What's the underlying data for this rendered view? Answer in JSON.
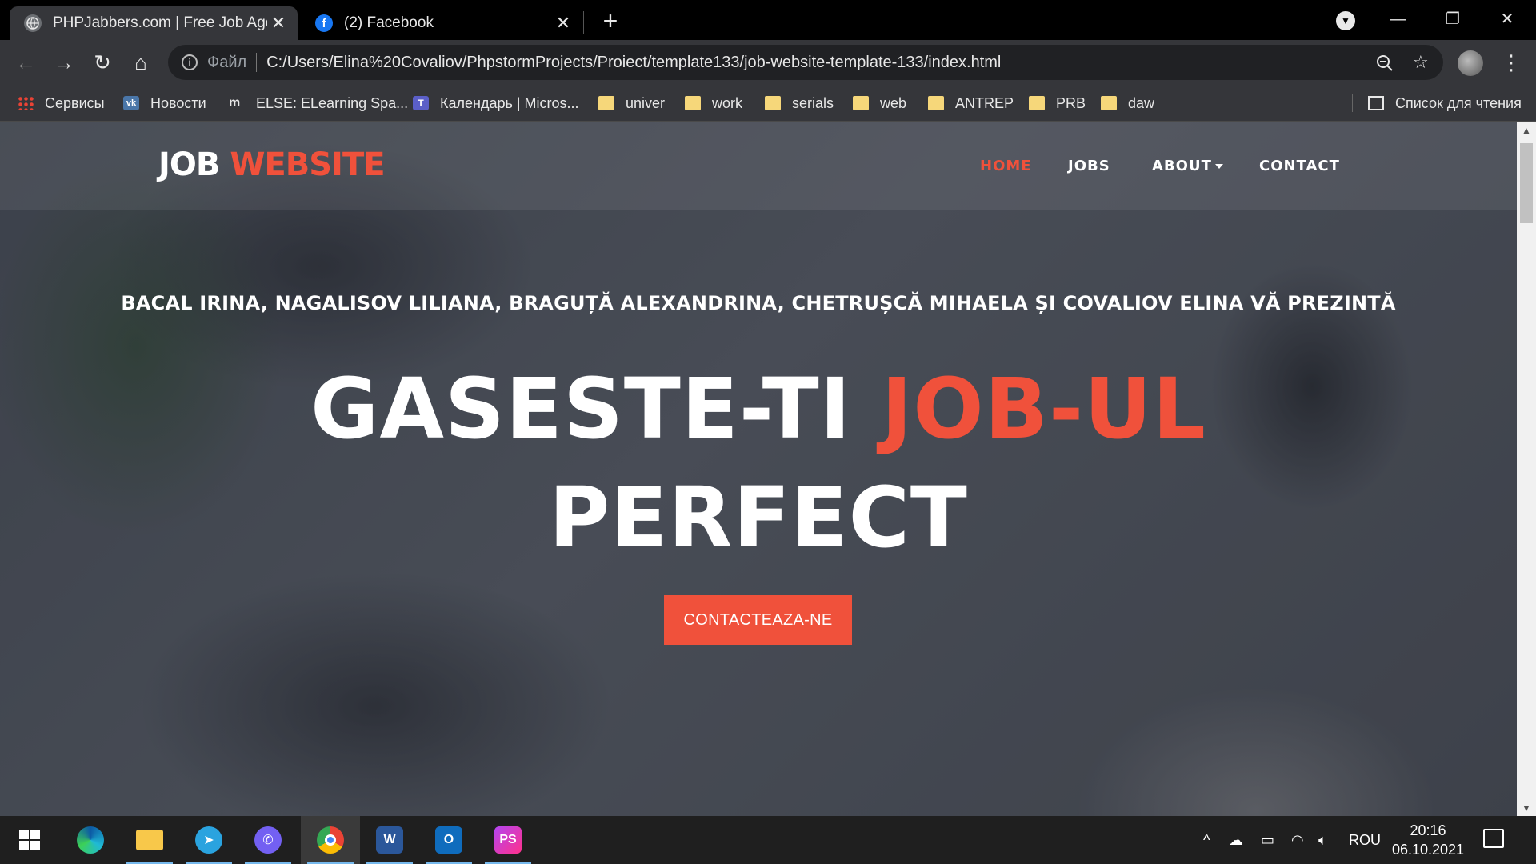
{
  "browser": {
    "tabs": [
      {
        "title": "PHPJabbers.com | Free Job Agency",
        "favicon": "globe-icon",
        "active": true
      },
      {
        "title": "(2) Facebook",
        "favicon": "facebook-icon",
        "active": false
      }
    ],
    "address": {
      "scheme_label": "Файл",
      "url": "C:/Users/Elina%20Covaliov/PhpstormProjects/Proiect/template133/job-website-template-133/index.html"
    },
    "bookmarks": [
      {
        "label": "Сервисы",
        "icon": "apps-grid-icon"
      },
      {
        "label": "Новости",
        "icon": "vk-icon"
      },
      {
        "label": "ELSE: ELearning Spa...",
        "icon": "moodle-icon"
      },
      {
        "label": "Календарь | Micros...",
        "icon": "teams-icon"
      },
      {
        "label": "univer",
        "icon": "folder-icon"
      },
      {
        "label": "work",
        "icon": "folder-icon"
      },
      {
        "label": "serials",
        "icon": "folder-icon"
      },
      {
        "label": "web",
        "icon": "folder-icon"
      },
      {
        "label": "ANTREP",
        "icon": "folder-icon"
      },
      {
        "label": "PRB",
        "icon": "folder-icon"
      },
      {
        "label": "daw",
        "icon": "folder-icon"
      }
    ],
    "reading_list": "Список для чтения"
  },
  "site": {
    "logo": {
      "part1": "JOB",
      "part2": "WEBSITE"
    },
    "nav": {
      "home": "HOME",
      "jobs": "JOBS",
      "about": "ABOUT",
      "contact": "CONTACT"
    },
    "hero": {
      "subtitle": "BACAL IRINA, NAGALISOV LILIANA, BRAGUȚĂ ALEXANDRINA, CHETRUȘCĂ MIHAELA ȘI COVALIOV ELINA VĂ PREZINTĂ",
      "headline_part1": "GASESTE-TI",
      "headline_accent": "JOB-UL",
      "headline_part2": "PERFECT",
      "cta": "CONTACTEAZA-NE"
    },
    "colors": {
      "accent": "#f0513b",
      "text": "#ffffff"
    }
  },
  "taskbar": {
    "apps": [
      "windows-start-icon",
      "edge-icon",
      "file-explorer-icon",
      "telegram-icon",
      "viber-icon",
      "chrome-icon",
      "word-icon",
      "outlook-icon",
      "phpstorm-icon"
    ],
    "language": "ROU",
    "time": "20:16",
    "date": "06.10.2021"
  }
}
